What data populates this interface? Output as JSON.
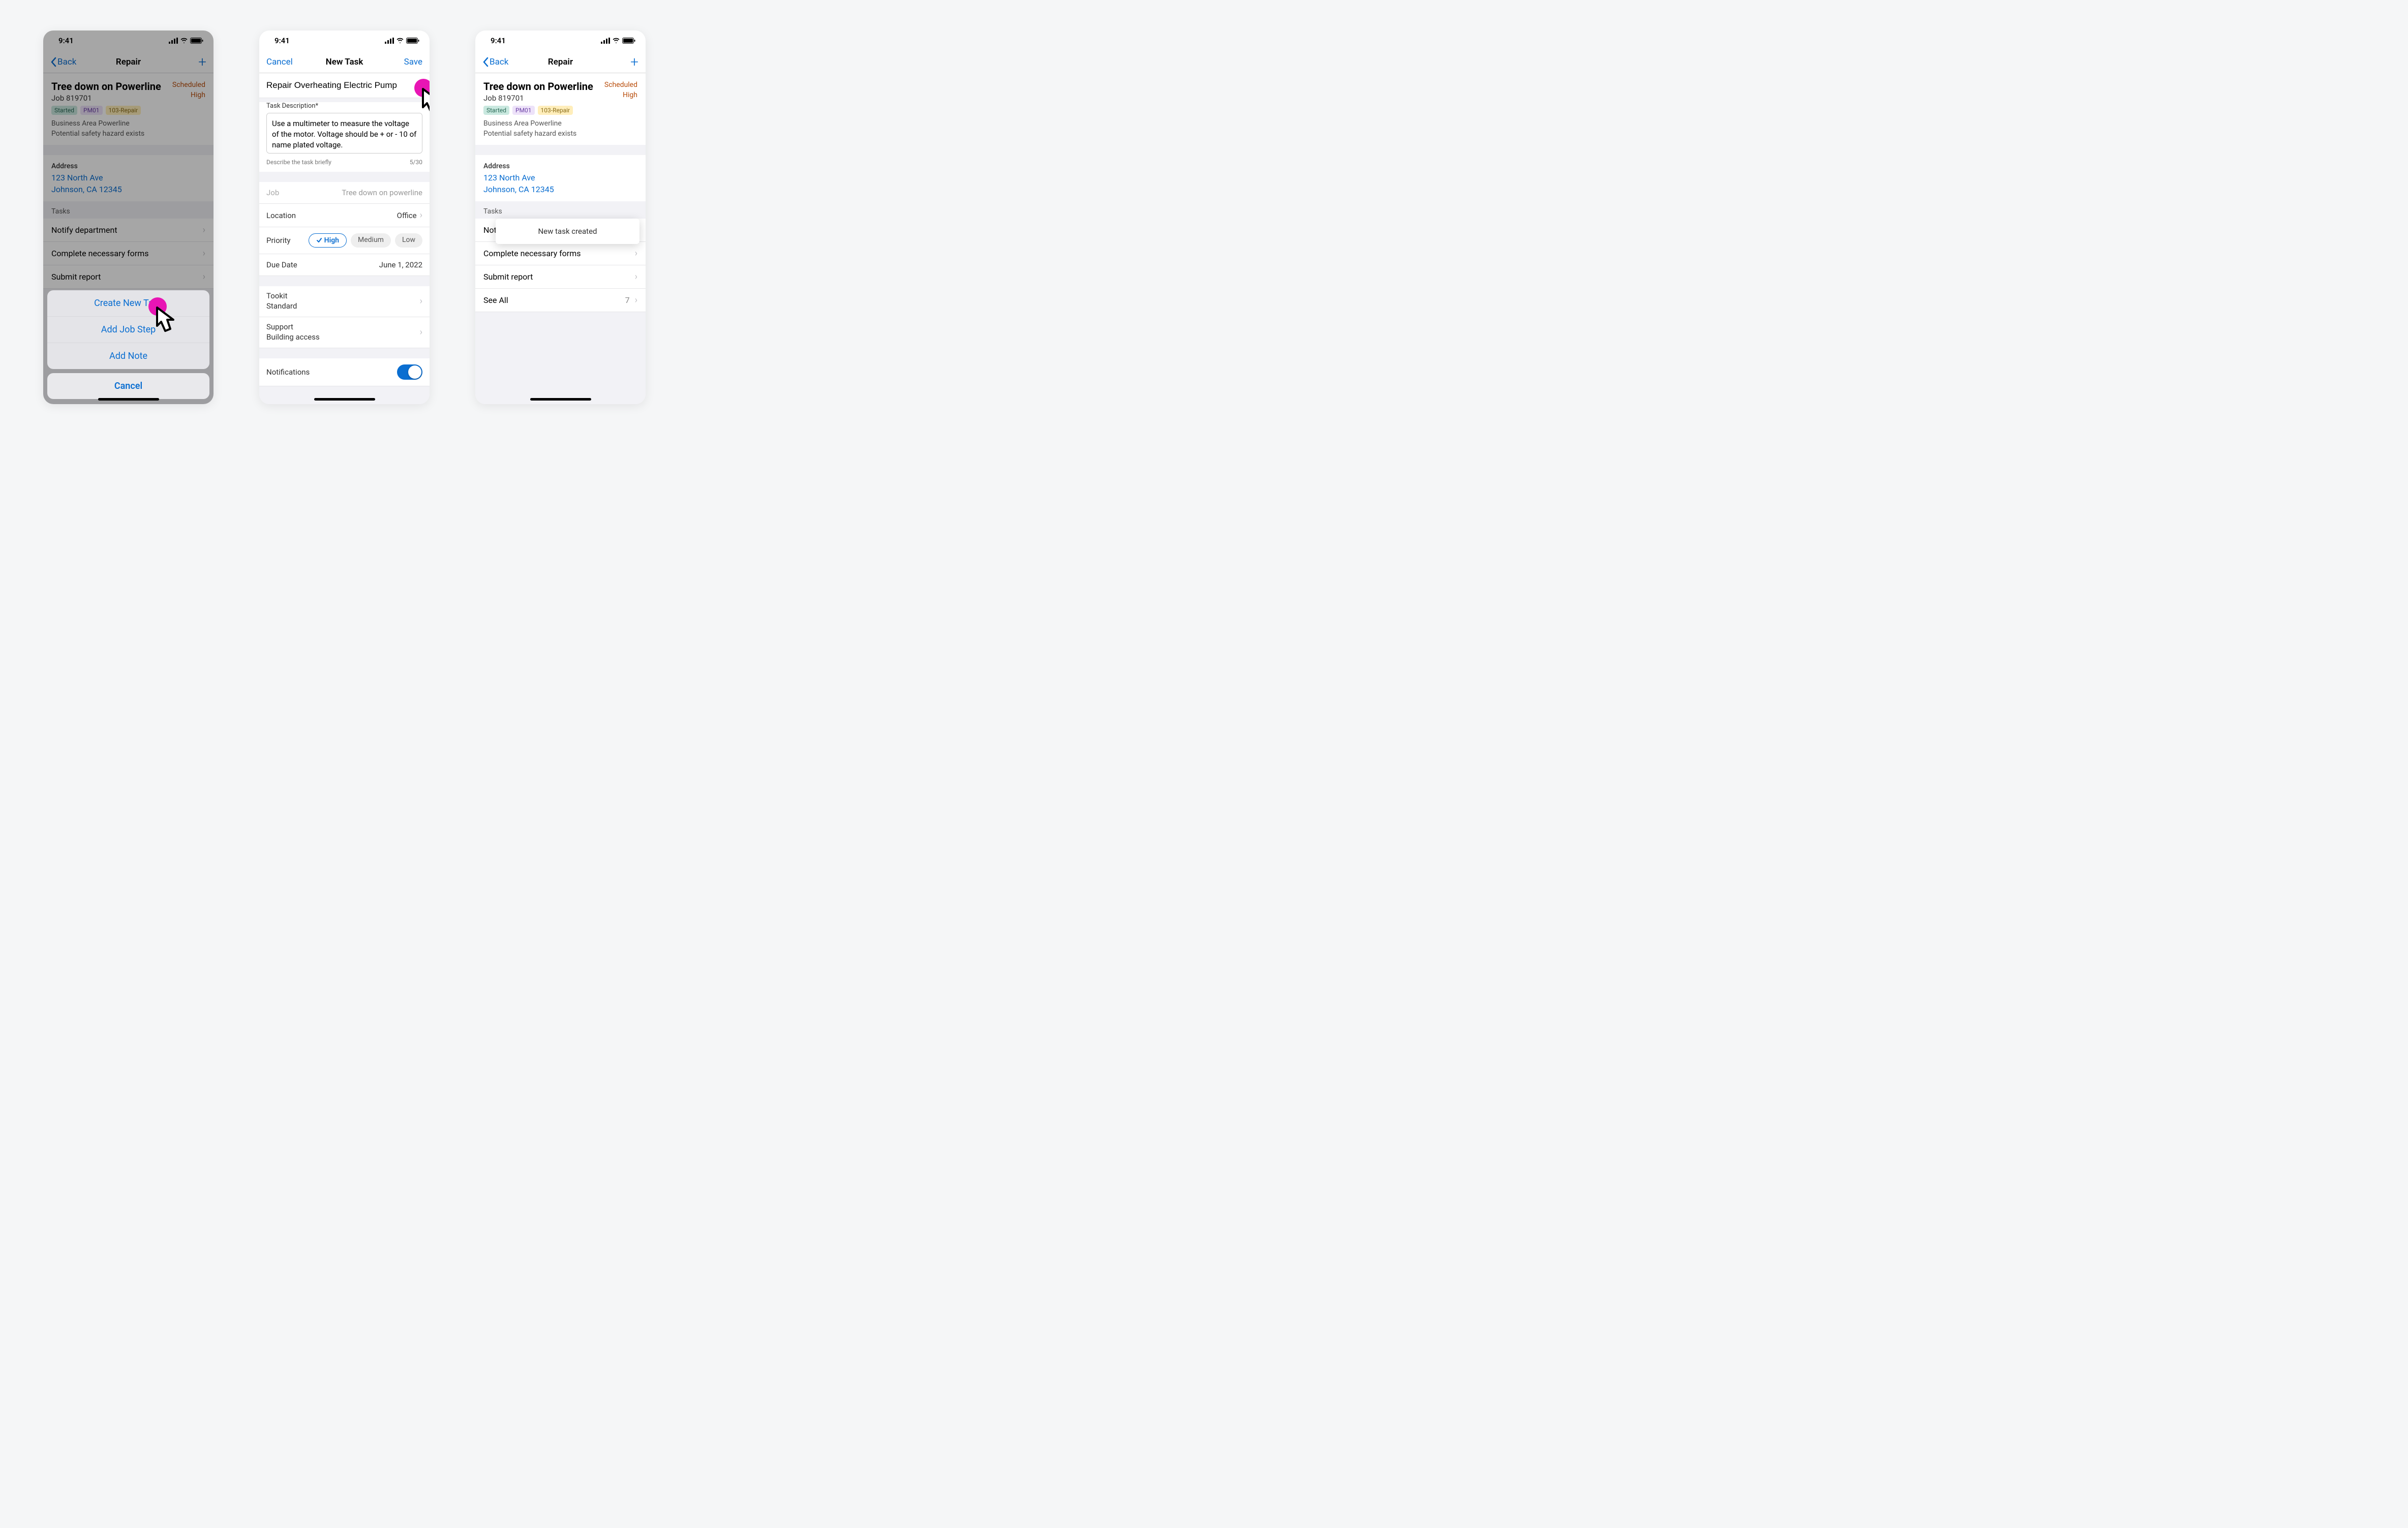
{
  "status_time": "9:41",
  "screen1": {
    "nav_back": "Back",
    "nav_title": "Repair",
    "job_title": "Tree down on Powerline",
    "job_number": "Job 819701",
    "status1": "Scheduled",
    "status2": "High",
    "tag_started": "Started",
    "tag_pm": "PM01",
    "tag_repair": "103-Repair",
    "desc1": "Business Area Powerline",
    "desc2": "Potential safety hazard exists",
    "addr_label": "Address",
    "addr1": "123 North Ave",
    "addr2": "Johnson, CA 12345",
    "tasks_header": "Tasks",
    "task1": "Notify department",
    "task2": "Complete necessary forms",
    "task3": "Submit report",
    "sheet_opt1": "Create New Task",
    "sheet_opt2": "Add Job Step",
    "sheet_opt3": "Add Note",
    "sheet_cancel": "Cancel"
  },
  "screen2": {
    "cancel": "Cancel",
    "save": "Save",
    "nav_title": "New Task",
    "title_value": "Repair Overheating Electric Pump",
    "desc_label": "Task Description*",
    "desc_value": "Use a multimeter to measure the voltage of the motor. Voltage should be + or - 10 of name plated voltage.",
    "hint": "Describe the task briefly",
    "counter": "5/30",
    "job_label": "Job",
    "job_value": "Tree down on powerline",
    "loc_label": "Location",
    "loc_value": "Office",
    "prio_label": "Priority",
    "prio_high": "High",
    "prio_med": "Medium",
    "prio_low": "Low",
    "due_label": "Due Date",
    "due_value": "June 1, 2022",
    "toolkit_label": "Tookit",
    "toolkit_value": "Standard",
    "support_label": "Support",
    "support_value": "Building access",
    "notif_label": "Notifications"
  },
  "screen3": {
    "nav_back": "Back",
    "nav_title": "Repair",
    "job_title": "Tree down on Powerline",
    "job_number": "Job 819701",
    "status1": "Scheduled",
    "status2": "High",
    "tag_started": "Started",
    "tag_pm": "PM01",
    "tag_repair": "103-Repair",
    "desc1": "Business Area Powerline",
    "desc2": "Potential safety hazard exists",
    "addr_label": "Address",
    "addr1": "123 North Ave",
    "addr2": "Johnson, CA 12345",
    "tasks_header": "Tasks",
    "task1": "Notify department",
    "task2": "Complete necessary forms",
    "task3": "Submit report",
    "see_all": "See All",
    "see_all_count": "7",
    "toast": "New task created"
  }
}
